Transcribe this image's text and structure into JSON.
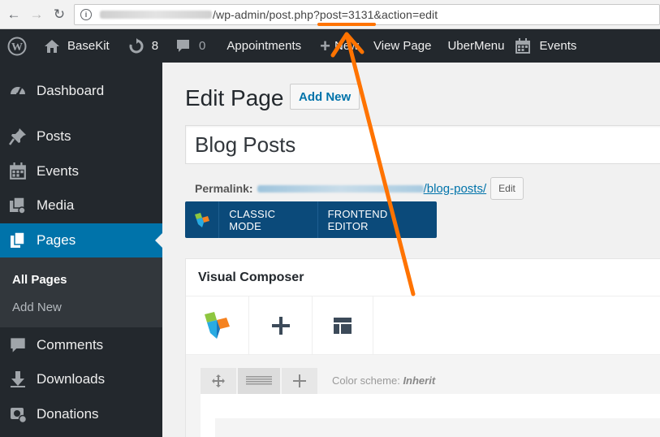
{
  "browser": {
    "url_path": "/wp-admin/post.php?post=3131&action=edit"
  },
  "adminbar": {
    "site_name": "BaseKit",
    "updates_count": "8",
    "comments_count": "0",
    "items": [
      "Appointments",
      "New",
      "View Page",
      "UberMenu",
      "Events"
    ]
  },
  "sidebar": {
    "items": [
      {
        "label": "Dashboard",
        "icon": "dashboard-icon"
      },
      {
        "label": "Posts",
        "icon": "pin-icon"
      },
      {
        "label": "Events",
        "icon": "calendar-icon"
      },
      {
        "label": "Media",
        "icon": "media-icon"
      },
      {
        "label": "Pages",
        "icon": "pages-icon"
      },
      {
        "label": "Comments",
        "icon": "comment-icon"
      },
      {
        "label": "Downloads",
        "icon": "download-icon"
      },
      {
        "label": "Donations",
        "icon": "donations-icon"
      }
    ],
    "submenu": [
      "All Pages",
      "Add New"
    ]
  },
  "main": {
    "page_title": "Edit Page",
    "add_new_label": "Add New",
    "post_title": "Blog Posts",
    "permalink_label": "Permalink:",
    "permalink_slug": "/blog-posts/",
    "permalink_edit": "Edit",
    "vc_classic": "CLASSIC MODE",
    "vc_frontend": "FRONTEND EDITOR",
    "vc_panel_title": "Visual Composer",
    "color_scheme_label": "Color scheme:",
    "color_scheme_value": "Inherit"
  },
  "colors": {
    "admin_dark": "#23282d",
    "accent_blue": "#0073aa",
    "vc_blue": "#0b4a7a",
    "annotation_orange": "#ff7300"
  }
}
